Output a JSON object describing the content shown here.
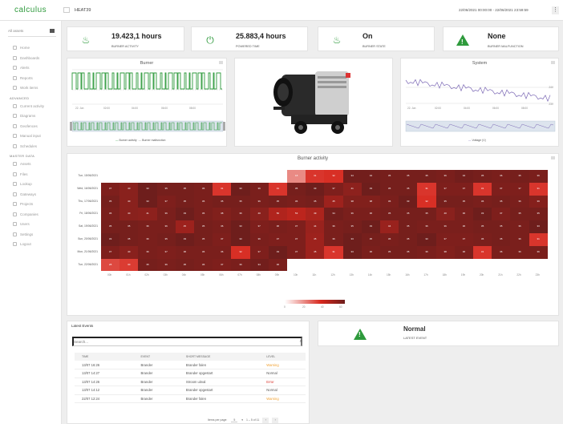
{
  "app": {
    "logo": "calculus",
    "asset_name": "HEAT39",
    "date_range": "22/06/2021 00:00:00 - 22/06/2021 23:59:59",
    "menu_glyph": "⋮"
  },
  "sidebar": {
    "asset_select": "All assets",
    "items_top": [
      {
        "label": "Home",
        "icon": "home-icon"
      },
      {
        "label": "Dashboards",
        "icon": "dashboard-icon"
      },
      {
        "label": "Alerts",
        "icon": "alert-icon"
      },
      {
        "label": "Reports",
        "icon": "reports-icon"
      },
      {
        "label": "Work items",
        "icon": "work-items-icon"
      }
    ],
    "section_advanced": "ADVANCED",
    "items_advanced": [
      {
        "label": "Current activity",
        "icon": "activity-icon"
      },
      {
        "label": "Diagrams",
        "icon": "diagram-icon"
      },
      {
        "label": "Geofences",
        "icon": "geofence-icon"
      },
      {
        "label": "Manual input",
        "icon": "keyboard-icon"
      },
      {
        "label": "Schedules",
        "icon": "calendar-icon"
      }
    ],
    "section_master": "MASTER DATA",
    "items_master": [
      {
        "label": "Assets",
        "icon": "asset-icon"
      },
      {
        "label": "Files",
        "icon": "folder-icon"
      },
      {
        "label": "Lookup",
        "icon": "lookup-icon"
      },
      {
        "label": "Gateways",
        "icon": "gateway-icon"
      },
      {
        "label": "Projects",
        "icon": "projects-icon"
      },
      {
        "label": "Companies",
        "icon": "companies-icon"
      },
      {
        "label": "Users",
        "icon": "users-icon"
      },
      {
        "label": "Settings",
        "icon": "gear-icon"
      },
      {
        "label": "Logout",
        "icon": "logout-icon"
      }
    ]
  },
  "kpis": [
    {
      "value": "19.423,1 hours",
      "label": "BURNER ACTIVITY",
      "icon": "flame-icon"
    },
    {
      "value": "25.883,4 hours",
      "label": "POWERED TIME",
      "icon": "plug-icon"
    },
    {
      "value": "On",
      "label": "BURNER STATE",
      "icon": "flame-icon"
    },
    {
      "value": "None",
      "label": "BURNER MALFUNCTION",
      "icon": "warning-icon"
    }
  ],
  "burner_panel": {
    "title": "Burner",
    "xticks": [
      "22. Jun",
      "02:00",
      "04:00",
      "06:00",
      "08:00"
    ],
    "legend": [
      "Burner activity",
      "Burner malfunction"
    ],
    "colors": {
      "activity": "#2e9a3c",
      "malfunction": "#888888"
    }
  },
  "system_panel": {
    "title": "System",
    "xticks": [
      "22. Jun",
      "02:00",
      "04:00",
      "06:00",
      "08:00"
    ],
    "yticks": [
      "24V",
      "23V"
    ],
    "legend": [
      "Voltage (V)"
    ],
    "color": "#7b68b5"
  },
  "heatmap": {
    "title": "Burner activity",
    "rows": [
      "Tue, 15/06/2021",
      "Wed, 16/06/2021",
      "Thu, 17/06/2021",
      "Fri, 18/06/2021",
      "Sat, 19/06/2021",
      "Sun, 20/06/2021",
      "Mon, 21/06/2021",
      "Tue, 22/06/2021"
    ],
    "cols": [
      "00h",
      "01h",
      "02h",
      "03h",
      "04h",
      "05h",
      "06h",
      "07h",
      "08h",
      "09h",
      "10h",
      "11h",
      "12h",
      "13h",
      "14h",
      "15h",
      "16h",
      "17h",
      "18h",
      "19h",
      "20h",
      "21h",
      "22h",
      "23h"
    ],
    "values": [
      [
        null,
        null,
        null,
        null,
        null,
        null,
        null,
        null,
        null,
        null,
        18,
        31,
        32,
        34,
        34,
        35,
        35,
        35,
        36,
        34,
        35,
        36,
        35,
        36
      ],
      [
        37,
        40,
        33,
        35,
        35,
        36,
        31,
        33,
        36,
        31,
        35,
        33,
        37,
        41,
        33,
        35,
        35,
        31,
        37,
        37,
        31,
        37,
        37,
        31
      ],
      [
        35,
        40,
        33,
        37,
        35,
        36,
        35,
        35,
        36,
        35,
        36,
        35,
        45,
        38,
        38,
        36,
        33,
        32,
        35,
        35,
        36,
        35,
        36,
        39
      ],
      [
        36,
        40,
        41,
        36,
        33,
        36,
        38,
        36,
        40,
        50,
        53,
        49,
        34,
        36,
        36,
        35,
        35,
        35,
        40,
        36,
        33,
        37,
        35,
        35
      ],
      [
        35,
        35,
        36,
        36,
        45,
        35,
        36,
        33,
        37,
        36,
        37,
        44,
        36,
        35,
        33,
        44,
        35,
        36,
        36,
        36,
        35,
        35,
        36,
        33
      ],
      [
        33,
        35,
        36,
        35,
        33,
        35,
        37,
        33,
        36,
        37,
        37,
        45,
        36,
        33,
        35,
        36,
        35,
        33,
        37,
        37,
        36,
        35,
        36,
        31
      ],
      [
        37,
        40,
        36,
        37,
        36,
        36,
        36,
        32,
        37,
        33,
        37,
        45,
        31,
        33,
        36,
        35,
        35,
        36,
        38,
        36,
        31,
        36,
        36,
        36
      ],
      [
        28,
        30,
        35,
        36,
        35,
        36,
        37,
        36,
        34,
        36,
        null,
        null,
        null,
        null,
        null,
        null,
        null,
        null,
        null,
        null,
        null,
        null,
        null,
        null
      ]
    ],
    "scale_ticks": [
      "0",
      "20",
      "40",
      "60"
    ],
    "scale_max": 60
  },
  "events": {
    "title": "Latest Events",
    "search_placeholder": "Search...",
    "columns": [
      "TIME",
      "EVENT",
      "SHORT MESSAGE",
      "LEVEL"
    ],
    "rows": [
      {
        "time": "13/07 16:26",
        "event": "Brander",
        "message": "Brander falen",
        "level": "Warning",
        "color": "#f0a030"
      },
      {
        "time": "13/07 14:27",
        "event": "Brander",
        "message": "Brander opgestart",
        "level": "Normal",
        "color": "#555555"
      },
      {
        "time": "13/07 14:26",
        "event": "Brander",
        "message": "Stroom uitval",
        "level": "Error",
        "color": "#d9342b"
      },
      {
        "time": "13/07 14:12",
        "event": "Brander",
        "message": "Brander opgestart",
        "level": "Normal",
        "color": "#555555"
      },
      {
        "time": "22/07 12:24",
        "event": "Brander",
        "message": "Brander falen",
        "level": "Warning",
        "color": "#f0a030"
      }
    ],
    "pager": {
      "items_per_page_label": "Items per page:",
      "items_per_page": "5",
      "range": "1 – 5 of 11"
    }
  },
  "latest_event": {
    "title": "Normal",
    "subtitle": "LATEST EVENT",
    "icon": "warning-icon"
  }
}
